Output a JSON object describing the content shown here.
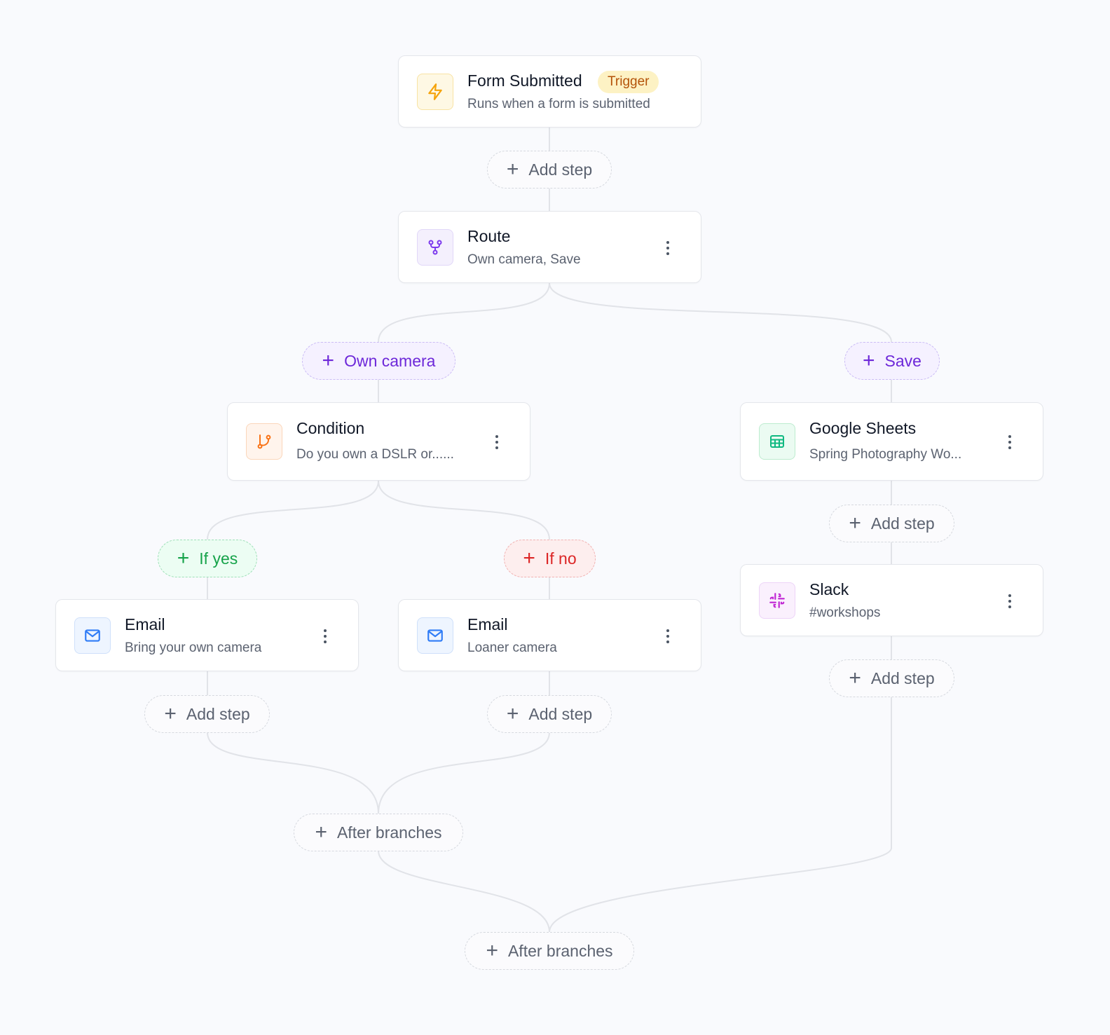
{
  "nodes": {
    "trigger": {
      "title": "Form Submitted",
      "badge": "Trigger",
      "subtitle": "Runs when a form is submitted",
      "icon": "lightning-icon"
    },
    "route": {
      "title": "Route",
      "subtitle": "Own camera, Save",
      "icon": "route-icon"
    },
    "condition": {
      "title": "Condition",
      "subtitle": "Do you own a DSLR or......",
      "icon": "branch-icon"
    },
    "sheets": {
      "title": "Google Sheets",
      "subtitle": "Spring Photography Wo...",
      "icon": "table-icon"
    },
    "slack": {
      "title": "Slack",
      "subtitle": "#workshops",
      "icon": "slack-icon"
    },
    "email_yes": {
      "title": "Email",
      "subtitle": "Bring your own camera",
      "icon": "mail-icon"
    },
    "email_no": {
      "title": "Email",
      "subtitle": "Loaner camera",
      "icon": "mail-icon"
    }
  },
  "pills": {
    "add_step": "Add step",
    "own_camera": "Own camera",
    "save": "Save",
    "if_yes": "If yes",
    "if_no": "If no",
    "after_branches": "After branches"
  },
  "colors": {
    "canvas_bg": "#f9fafd",
    "connector": "#e1e3e8",
    "route_branch": "#6d28d9",
    "yes_branch": "#16a34a",
    "no_branch": "#dc2626",
    "trigger_badge": "#b45309"
  }
}
